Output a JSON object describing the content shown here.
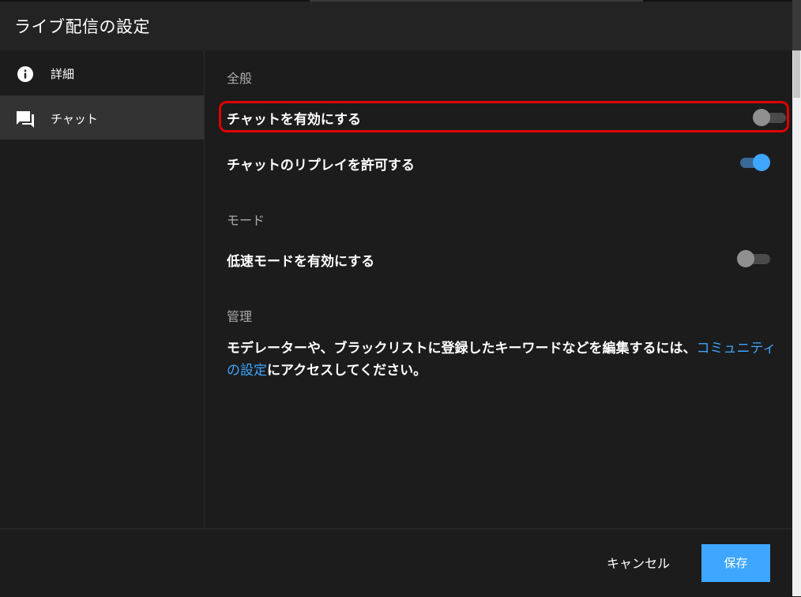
{
  "dialog": {
    "title": "ライブ配信の設定"
  },
  "sidebar": {
    "items": [
      {
        "label": "詳細",
        "icon": "info-icon",
        "active": false
      },
      {
        "label": "チャット",
        "icon": "chat-icon",
        "active": true
      }
    ]
  },
  "content": {
    "general": {
      "title": "全般",
      "enable_chat": {
        "label": "チャットを有効にする",
        "on": false
      },
      "chat_replay": {
        "label": "チャットのリプレイを許可する",
        "on": true
      }
    },
    "mode": {
      "title": "モード",
      "slow_mode": {
        "label": "低速モードを有効にする",
        "on": false
      }
    },
    "management": {
      "title": "管理",
      "desc_before": "モデレーターや、ブラックリストに登録したキーワードなどを編集するには、",
      "link": "コミュニティの設定",
      "desc_after": "にアクセスしてください。"
    }
  },
  "footer": {
    "cancel": "キャンセル",
    "save": "保存"
  },
  "colors": {
    "accent": "#3ea6ff",
    "highlight": "#e00000",
    "background": "#1c1c1c"
  }
}
